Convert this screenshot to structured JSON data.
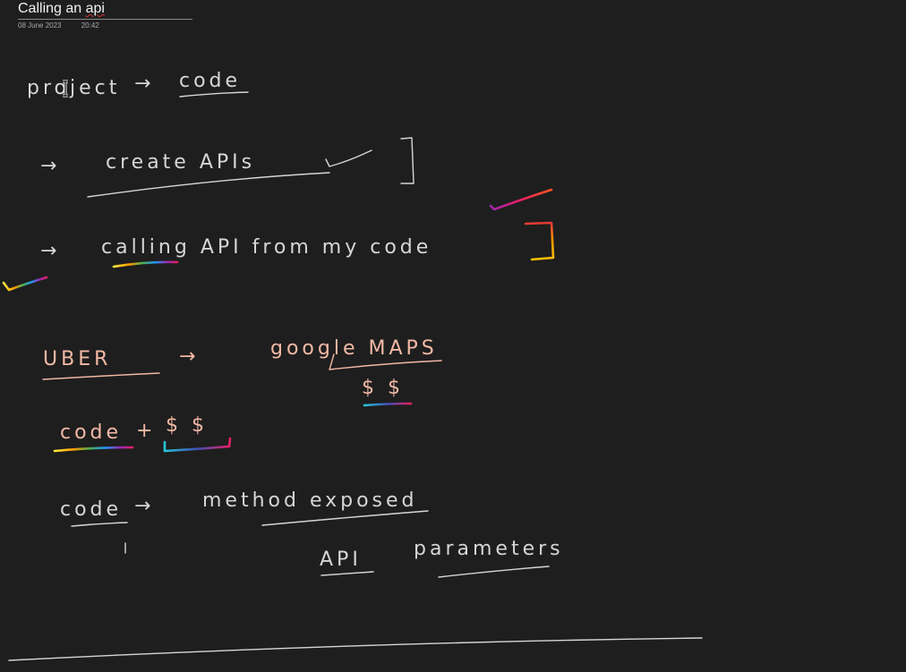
{
  "page": {
    "title_before": "Calling an ",
    "title_misspelled": "api",
    "date": "08 June 2023",
    "time": "20:42"
  },
  "notes": {
    "line1_left": "project",
    "line1_arrow": "→",
    "line1_right": "code",
    "line2_arrow": "→",
    "line2_text": "create   APIs",
    "line3_arrow": "→",
    "line3_text": "calling  API  from  my  code",
    "line4_left": "UBER",
    "line4_arrow": "→",
    "line4_right": "google  MAPS",
    "line4_money": "$ $",
    "line5_left": "code",
    "line5_plus": "+",
    "line5_money": "$ $",
    "line6_left": "code",
    "line6_arrow": "→",
    "line6_right": "method  exposed",
    "line7_left": "API",
    "line7_right": "parameters"
  },
  "colors": {
    "background": "#1e1e1e",
    "ink_white": "#d6d6d6",
    "ink_peach": "#f3b9a5",
    "rainbow": [
      "#e53935",
      "#ff9800",
      "#ffeb3b",
      "#4caf50",
      "#2196f3",
      "#9c27b0",
      "#e91e63"
    ]
  }
}
